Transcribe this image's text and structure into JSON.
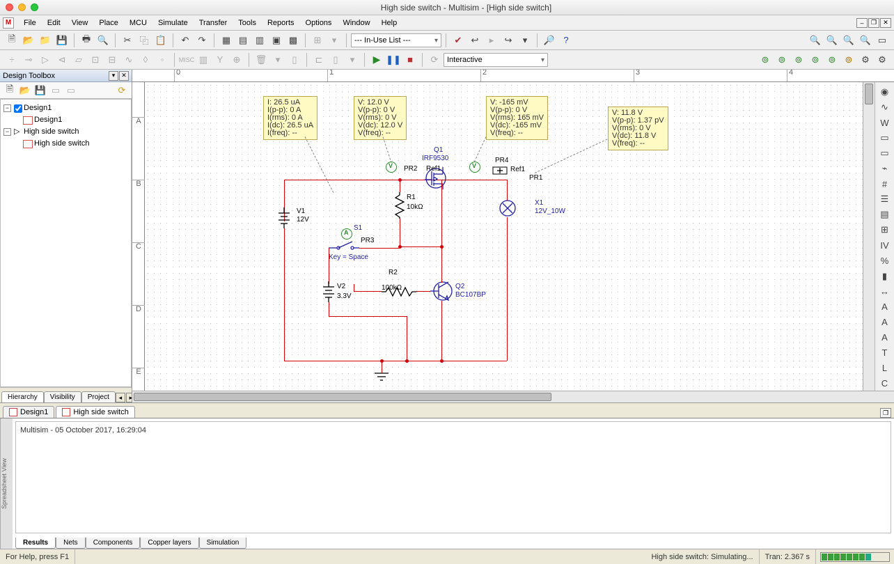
{
  "window": {
    "title": "High side switch - Multisim - [High side switch]"
  },
  "menu": {
    "items": [
      "File",
      "Edit",
      "View",
      "Place",
      "MCU",
      "Simulate",
      "Transfer",
      "Tools",
      "Reports",
      "Options",
      "Window",
      "Help"
    ]
  },
  "toolbar1": {
    "inuse_label": "--- In-Use List ---"
  },
  "toolbar2": {
    "sim_mode": "Interactive"
  },
  "toolbox": {
    "title": "Design Toolbox",
    "tree_root1": "Design1",
    "tree_child1": "Design1",
    "tree_root2": "High side switch",
    "tree_child2": "High side switch",
    "tabs": {
      "hierarchy": "Hierarchy",
      "visibility": "Visibility",
      "project": "Project"
    }
  },
  "doc_tabs": {
    "t1": "Design1",
    "t2": "High side switch"
  },
  "probes": {
    "p1": {
      "lines": [
        "I: 26.5 uA",
        "I(p-p): 0 A",
        "I(rms): 0 A",
        "I(dc): 26.5 uA",
        "I(freq): --"
      ]
    },
    "p2": {
      "lines": [
        "V: 12.0 V",
        "V(p-p): 0 V",
        "V(rms): 0 V",
        "V(dc): 12.0 V",
        "V(freq): --"
      ]
    },
    "p3": {
      "lines": [
        "V: -165 mV",
        "V(p-p): 0 V",
        "V(rms): 165 mV",
        "V(dc): -165 mV",
        "V(freq): --"
      ]
    },
    "p4": {
      "lines": [
        "V: 11.8 V",
        "V(p-p): 1.37 pV",
        "V(rms): 0 V",
        "V(dc): 11.8 V",
        "V(freq): --"
      ]
    }
  },
  "components": {
    "V1": {
      "ref": "V1",
      "val": "12V"
    },
    "V2": {
      "ref": "V2",
      "val": "3.3V"
    },
    "R1": {
      "ref": "R1",
      "val": "10kΩ"
    },
    "R2": {
      "ref": "R2",
      "val": "100kΩ"
    },
    "Q1": {
      "ref": "Q1",
      "val": "IRF9530"
    },
    "Q2": {
      "ref": "Q2",
      "val": "BC107BP"
    },
    "X1": {
      "ref": "X1",
      "val": "12V_10W"
    },
    "S1": {
      "ref": "S1",
      "key": "Key = Space"
    },
    "PR1": "PR1",
    "PR2": "PR2",
    "PR3": "PR3",
    "PR4": "PR4",
    "Ref1a": "Ref1",
    "Ref1b": "Ref1"
  },
  "log": {
    "line": "Multisim  -  05 October 2017, 16:29:04"
  },
  "out_tabs": {
    "results": "Results",
    "nets": "Nets",
    "components": "Components",
    "copper": "Copper layers",
    "simulation": "Simulation"
  },
  "status": {
    "help": "For Help, press F1",
    "sim": "High side switch: Simulating...",
    "tran": "Tran: 2.367 s"
  },
  "ruler_h_labels": [
    "0",
    "1",
    "2",
    "3",
    "4"
  ],
  "ruler_v_labels": [
    "A",
    "B",
    "C",
    "D",
    "E"
  ]
}
